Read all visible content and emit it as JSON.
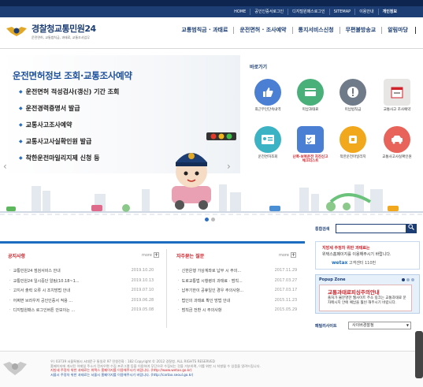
{
  "topbar": {
    "links": [
      "HOME",
      "공인인증서로그인",
      "디지털원패스로그인",
      "SITEMAP",
      "이용안내",
      "개인정보"
    ]
  },
  "header": {
    "logo_title_a": "경찰청",
    "logo_title_b": "교통민원24",
    "logo_sub": "운전면허, 교통범칙금, 과태료, 교통조사업무",
    "gnb": [
      "교통범칙금 · 과태료",
      "운전면허 · 조사예약",
      "통지서비스신청",
      "무편불방송교",
      "알림마당"
    ]
  },
  "hero": {
    "title": "운전면허정보 조회·교통조사예약",
    "items": [
      "운전면허 적성검사(갱신) 기간 조회",
      "운전경력증명서 발급",
      "교통사고조사예약",
      "교통사고사실확인원 발급",
      "착한운전마일리지제 신청 등"
    ]
  },
  "quick": {
    "title": "바로가기",
    "items": [
      {
        "label": "최근무인단속내역",
        "color": "#4a7fd4",
        "icon": "thumb-icon"
      },
      {
        "label": "미납과태료",
        "color": "#49b07a",
        "icon": "card-icon"
      },
      {
        "label": "미납범칙금",
        "color": "#6f7b89",
        "icon": "warning-icon"
      },
      {
        "label": "교통사고 조사예약",
        "color": "#e8e6e4",
        "icon": "calendar-icon"
      },
      {
        "label": "운전면허조회",
        "color": "#3cb3c4",
        "icon": "license-icon"
      },
      {
        "label": "난폭·보복운전 자진신고 체크리스트",
        "color": "#4a7fd4",
        "icon": "checklist-icon",
        "red": true
      },
      {
        "label": "착한운전마일리지",
        "color": "#f2a81c",
        "icon": "mileage-icon"
      },
      {
        "label": "교통사고사실확인원",
        "color": "#e8635a",
        "icon": "car-crash-icon"
      }
    ]
  },
  "search": {
    "label": "통합검색",
    "button": "🔍"
  },
  "notice": {
    "title": "공지사항",
    "more": "more",
    "items": [
      {
        "t": "교통민원24 점검서비스 안내",
        "d": "2019.10.20"
      },
      {
        "t": "교통민원24 일시중단 알림(10.18~1...",
        "d": "2019.10.13"
      },
      {
        "t": "고지서 출력 오류 시 조치방법 안내",
        "d": "2019.07.10"
      },
      {
        "t": "어쩌면 브라우저 공인인증서 적용 ...",
        "d": "2019.06.28"
      },
      {
        "t": "디지털원패스 로그인버튼 안보이는 ...",
        "d": "2019.05.08"
      }
    ]
  },
  "faq": {
    "title": "자주묻는 질문",
    "more": "more",
    "items": [
      {
        "t": "신한은행 가상계좌로 납부 시 주의...",
        "d": "2017.11.29"
      },
      {
        "t": "도로교통법 시행령의 과태료 · 범칙...",
        "d": "2017.03.27"
      },
      {
        "t": "납부기한이 공휴일인 경우 주의사항...",
        "d": "2017.03.17"
      },
      {
        "t": "법인의 과태료 확인 방법 안내",
        "d": "2015.11.23"
      },
      {
        "t": "범칙금 전환 시 주의사항",
        "d": "2015.05.29"
      }
    ]
  },
  "banner": {
    "l1": "지방세 주정차 위반 과태료는",
    "l2": "위택스홈페이지를 이용해주시기 바랍니다.",
    "brand": "wetax",
    "l3": "고객센터 110번"
  },
  "popup": {
    "head": "Popup Zone",
    "title": "교통과태료피싱주의안내",
    "body": "출처가 불분명한 웹사이트 주소 링크는 교통과태료 문자메시지 안에 예납을 훨씬 해주시기 바랍니다."
  },
  "family": {
    "label": "패밀리사이트",
    "value": "사이버경찰청"
  },
  "footer": {
    "line1": "우) 03739 서울특별시 서대문구 통일로 97 민원전화 : 182    Copyright © 2012 경찰청. ALL RIGHTS RESERVED",
    "line2": "홈페이지에 게시된 이메일 주소가 전자우편 수집 프로그램 등을 이용하여 무단으로 수집되는 것을 거부하며, 이를 위반 시 처벌될 수 있음을 알려드립니다.",
    "line3": "지방세 주정차 위반 과태료는 위택스 홈페이지를 이용해주시기 바랍니다. (http://www.wetax.go.kr)",
    "line4": "서울시 주정차 위반 과태료는 서울시 홈페이지를 이용해주시기 바랍니다. (http://cartax.seoul.go.kr)"
  }
}
